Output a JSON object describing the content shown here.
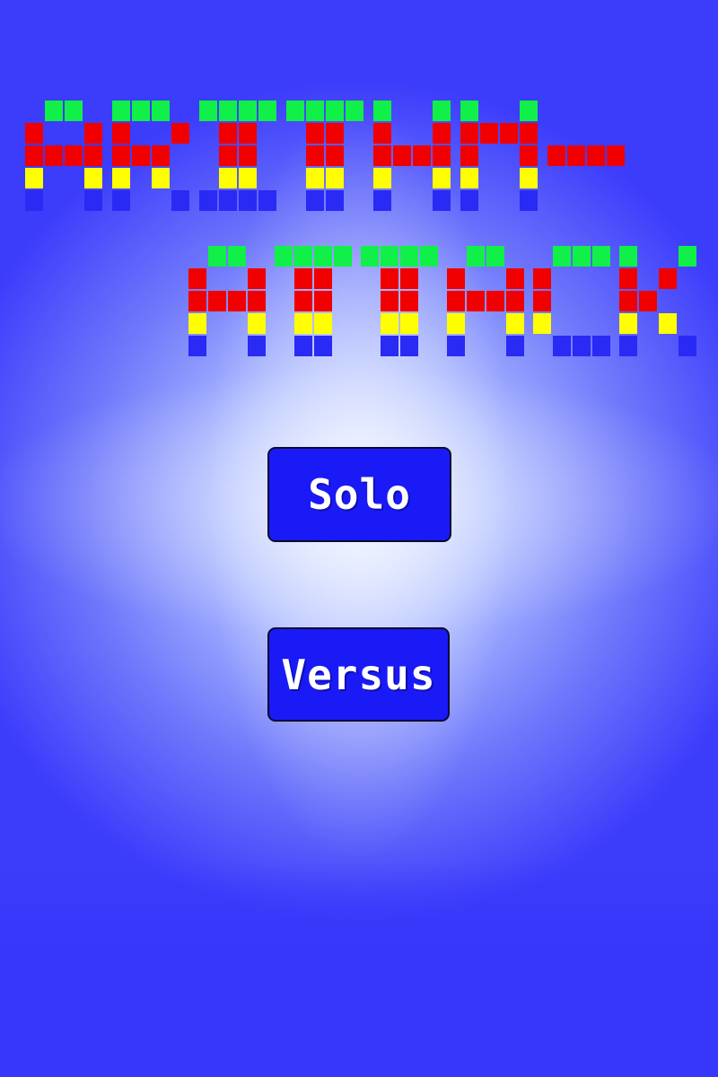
{
  "game": {
    "title_line1": "ARITHM-",
    "title_line2": "ATTACK",
    "title_colors": [
      "#10f048",
      "#f00000",
      "#ffff00",
      "#2a2af5"
    ]
  },
  "menu": {
    "solo_label": "Solo",
    "versus_label": "Versus"
  },
  "colors": {
    "background": "#3737fb",
    "button_fill": "#1a1af7",
    "button_border": "#0b0b2e",
    "button_text": "#ffffff"
  }
}
